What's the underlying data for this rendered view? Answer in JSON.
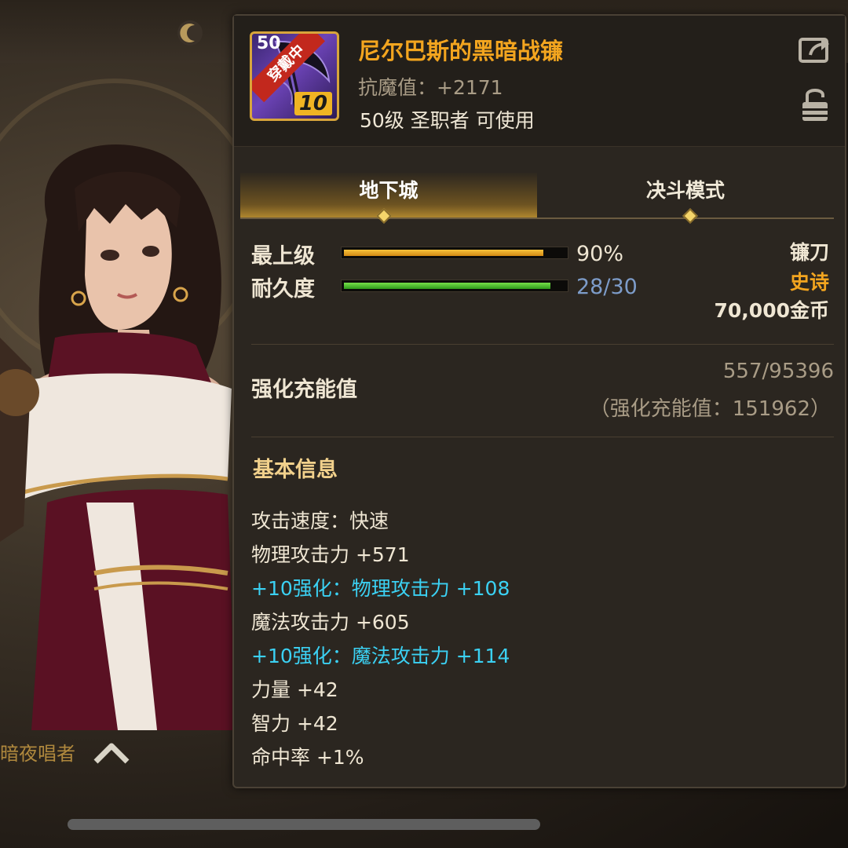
{
  "character": {
    "name": "暗夜唱者"
  },
  "item": {
    "level_num": "50",
    "equipped_badge": "穿戴中",
    "enhance_level": "10",
    "name": "尼尔巴斯的黑暗战镰",
    "stat": "抗魔值：+2171",
    "requirement": "50级 圣职者 可使用"
  },
  "tabs": [
    {
      "label": "地下城",
      "active": true
    },
    {
      "label": "决斗模式",
      "active": false
    }
  ],
  "grade": {
    "label": "最上级",
    "percent": 90,
    "value": "90%"
  },
  "durability": {
    "label": "耐久度",
    "current": 28,
    "max": 30,
    "value": "28/30"
  },
  "info": {
    "type": "镰刀",
    "rarity": "史诗",
    "price": "70,000金币"
  },
  "charge": {
    "label": "强化充能值",
    "value": "557/95396",
    "total": "（强化充能值：151962）"
  },
  "basic_info": {
    "title": "基本信息",
    "attributes": [
      {
        "text": "攻击速度：快速",
        "enhanced": false
      },
      {
        "text": "物理攻击力 +571",
        "enhanced": false
      },
      {
        "text": "+10强化：物理攻击力 +108",
        "enhanced": true
      },
      {
        "text": "魔法攻击力 +605",
        "enhanced": false
      },
      {
        "text": "+10强化：魔法攻击力 +114",
        "enhanced": true
      },
      {
        "text": "力量 +42",
        "enhanced": false
      },
      {
        "text": "智力 +42",
        "enhanced": false
      },
      {
        "text": "命中率 +1%",
        "enhanced": false
      }
    ]
  },
  "colors": {
    "title_orange": "#f3a51f",
    "rarity_orange": "#f3a51f",
    "enhanced_cyan": "#3bd1f3",
    "durability_value": "#7d9cc9"
  }
}
